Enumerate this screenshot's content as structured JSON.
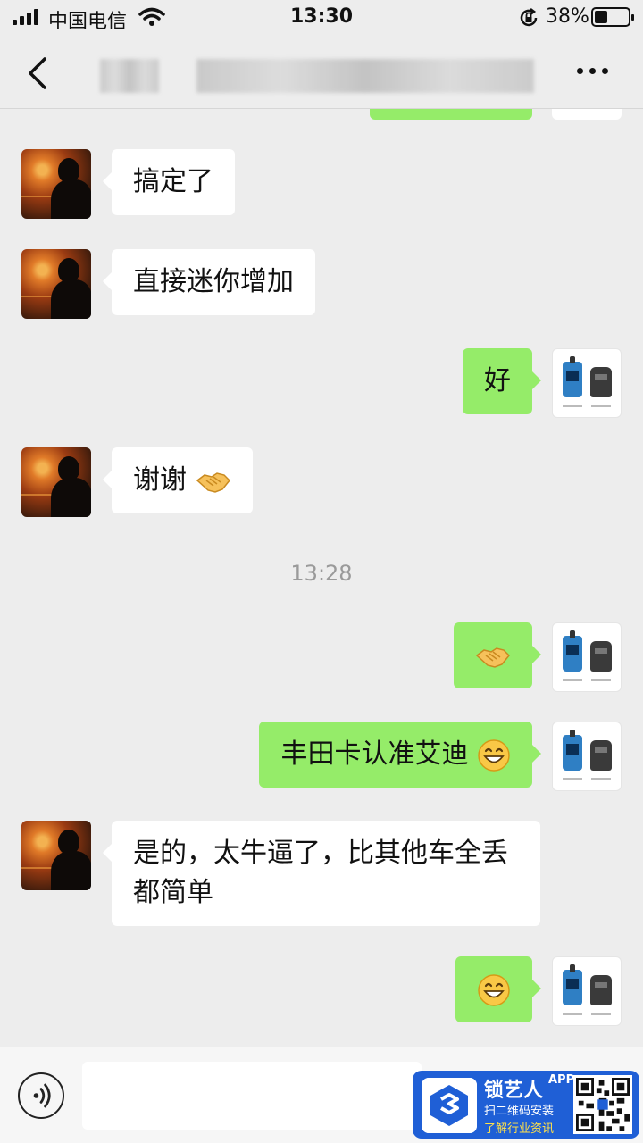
{
  "status_bar": {
    "carrier": "中国电信",
    "time": "13:30",
    "battery_percent": "38%",
    "battery_level": 0.38,
    "icons": [
      "signal-icon",
      "wifi-icon",
      "rotation-lock-icon",
      "battery-icon"
    ]
  },
  "nav": {
    "back_icon": "chevron-left-icon",
    "title_state": "blurred",
    "more_icon": "more-dots-icon"
  },
  "chat": {
    "timestamp": "13:28",
    "messages": [
      {
        "side": "left",
        "text": "搞定了"
      },
      {
        "side": "left",
        "text": "直接迷你增加"
      },
      {
        "side": "right",
        "text": "好"
      },
      {
        "side": "left",
        "text": "谢谢",
        "emoji": "handshake-emoji"
      },
      {
        "side": "right",
        "text": "",
        "emoji": "handshake-emoji"
      },
      {
        "side": "right",
        "text": "丰田卡认准艾迪",
        "emoji": "grin-emoji"
      },
      {
        "side": "left",
        "text": "是的，太牛逼了，比其他车全丢都简单"
      },
      {
        "side": "right",
        "text": "",
        "emoji": "grin-emoji"
      }
    ]
  },
  "input_bar": {
    "voice_icon": "voice-icon",
    "text_value": ""
  },
  "watermark": {
    "brand": "锁艺人",
    "badge": "APP",
    "line1": "扫二维码安装",
    "line2": "了解行业资讯"
  },
  "colors": {
    "background": "#ededed",
    "sent_bubble": "#95ec69",
    "received_bubble": "#ffffff",
    "banner": "#1f5fd6"
  }
}
